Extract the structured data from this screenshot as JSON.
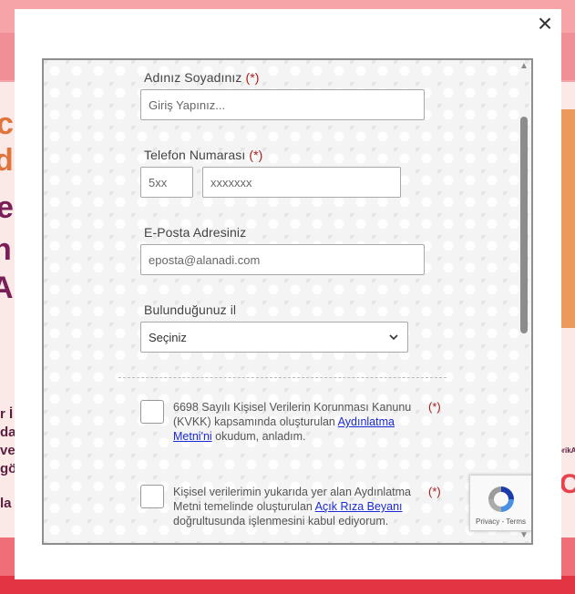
{
  "background": {
    "letters_left": [
      "c",
      "d",
      "e",
      "n",
      "A"
    ],
    "small_left": [
      "r İ",
      "da",
      "ve",
      "gö",
      "la"
    ],
    "small_right_top": "orikA",
    "small_right_big": "Co"
  },
  "modal": {
    "close_label": "×",
    "form": {
      "name_label": "Adınız Soyadınız",
      "name_required": "(*)",
      "name_placeholder": "Giriş Yapınız...",
      "phone_label": "Telefon Numarası",
      "phone_required": "(*)",
      "phone_prefix_placeholder": "5xx",
      "phone_number_placeholder": "xxxxxxx",
      "email_label": "E-Posta Adresiniz",
      "email_placeholder": "eposta@alanadi.com",
      "city_label": "Bulunduğunuz il",
      "city_selected": "Seçiniz"
    },
    "consents": [
      {
        "text_before": "6698 Sayılı Kişisel Verilerin Korunması Kanunu (KVKK) kapsamında oluşturulan ",
        "link": "Aydınlatma Metni'ni",
        "text_after": " okudum, anladım.",
        "required": "(*)"
      },
      {
        "text_before": "Kişisel verilerimin yukarıda yer alan Aydınlatma Metni temelinde oluşturulan ",
        "link": "Açık Rıza Beyanı",
        "text_after": " doğrultusunda işlenmesini kabul ediyorum.",
        "required": "(*)"
      }
    ],
    "recaptcha": {
      "privacy": "Privacy",
      "sep": " - ",
      "terms": "Terms"
    }
  },
  "colors": {
    "accent_required": "#a61d1d",
    "link": "#1a2ad6"
  }
}
